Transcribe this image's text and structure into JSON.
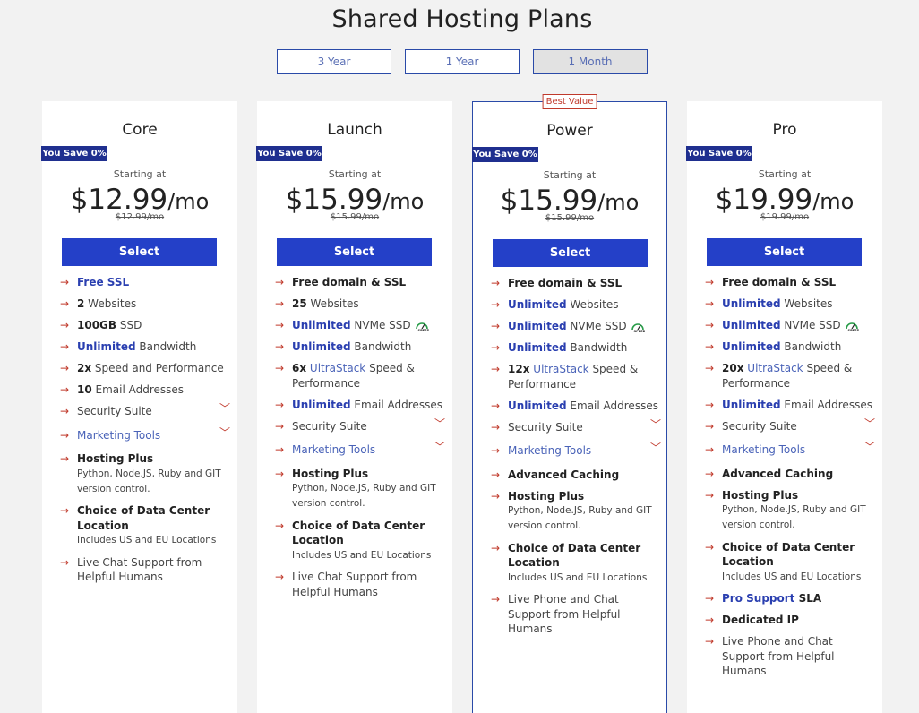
{
  "page": {
    "title": "Shared Hosting Plans"
  },
  "terms": [
    {
      "label": "3 Year",
      "active": false
    },
    {
      "label": "1 Year",
      "active": false
    },
    {
      "label": "1 Month",
      "active": true
    }
  ],
  "plans": [
    {
      "name": "Core",
      "badge": "",
      "save": "You Save 0%",
      "starting": "Starting at",
      "price": "$12.99",
      "per": "/mo",
      "old_price": "$12.99/mo",
      "button": "Select",
      "features": [
        [
          {
            "t": "Free SSL",
            "s": "blue"
          }
        ],
        [
          {
            "t": "2",
            "s": "b"
          },
          {
            "t": " Websites",
            "s": ""
          }
        ],
        [
          {
            "t": "100GB",
            "s": "b"
          },
          {
            "t": " SSD",
            "s": ""
          }
        ],
        [
          {
            "t": "Unlimited",
            "s": "blue"
          },
          {
            "t": " Bandwidth",
            "s": ""
          }
        ],
        [
          {
            "t": "2x",
            "s": "b"
          },
          {
            "t": " Speed and Performance",
            "s": ""
          }
        ],
        [
          {
            "t": "10",
            "s": "b"
          },
          {
            "t": " Email Addresses",
            "s": ""
          }
        ],
        [
          {
            "t": "Security Suite",
            "s": "",
            "exp": true
          }
        ],
        [
          {
            "t": "Marketing Tools",
            "s": "link",
            "exp": true
          }
        ],
        [
          {
            "t": "Hosting Plus",
            "s": "b"
          },
          {
            "t": "Python,   Node.JS,   Ruby and GIT version control.",
            "s": "sub"
          }
        ],
        [
          {
            "t": "Choice of Data Center Location",
            "s": "b"
          },
          {
            "t": "Includes US and EU Locations",
            "s": "sub"
          }
        ],
        [
          {
            "t": "Live Chat Support from Helpful Humans",
            "s": ""
          }
        ]
      ]
    },
    {
      "name": "Launch",
      "badge": "",
      "save": "You Save 0%",
      "starting": "Starting at",
      "price": "$15.99",
      "per": "/mo",
      "old_price": "$15.99/mo",
      "button": "Select",
      "features": [
        [
          {
            "t": "Free domain & SSL",
            "s": "b"
          }
        ],
        [
          {
            "t": "25",
            "s": "b"
          },
          {
            "t": " Websites",
            "s": ""
          }
        ],
        [
          {
            "t": "Unlimited",
            "s": "blue"
          },
          {
            "t": " NVMe SSD",
            "s": "",
            "speed": true
          }
        ],
        [
          {
            "t": "Unlimited",
            "s": "blue"
          },
          {
            "t": " Bandwidth",
            "s": ""
          }
        ],
        [
          {
            "t": "6x",
            "s": "b"
          },
          {
            "t": " ",
            "s": ""
          },
          {
            "t": "UltraStack",
            "s": "link"
          },
          {
            "t": " Speed & Performance",
            "s": ""
          }
        ],
        [
          {
            "t": "Unlimited",
            "s": "blue"
          },
          {
            "t": " Email Addresses",
            "s": ""
          }
        ],
        [
          {
            "t": "Security Suite",
            "s": "",
            "exp": true
          }
        ],
        [
          {
            "t": "Marketing Tools",
            "s": "link",
            "exp": true
          }
        ],
        [
          {
            "t": "Hosting Plus",
            "s": "b"
          },
          {
            "t": "Python,   Node.JS,   Ruby and GIT version control.",
            "s": "sub"
          }
        ],
        [
          {
            "t": "Choice of Data Center Location",
            "s": "b"
          },
          {
            "t": "Includes US and EU Locations",
            "s": "sub"
          }
        ],
        [
          {
            "t": "Live Chat Support from Helpful Humans",
            "s": ""
          }
        ]
      ]
    },
    {
      "name": "Power",
      "badge": "Best Value",
      "save": "You Save 0%",
      "starting": "Starting at",
      "price": "$15.99",
      "per": "/mo",
      "old_price": "$15.99/mo",
      "button": "Select",
      "features": [
        [
          {
            "t": "Free domain & SSL",
            "s": "b"
          }
        ],
        [
          {
            "t": "Unlimited",
            "s": "blue"
          },
          {
            "t": " Websites",
            "s": ""
          }
        ],
        [
          {
            "t": "Unlimited",
            "s": "blue"
          },
          {
            "t": " NVMe SSD",
            "s": "",
            "speed": true
          }
        ],
        [
          {
            "t": "Unlimited",
            "s": "blue"
          },
          {
            "t": " Bandwidth",
            "s": ""
          }
        ],
        [
          {
            "t": "12x",
            "s": "b"
          },
          {
            "t": " ",
            "s": ""
          },
          {
            "t": "UltraStack",
            "s": "link"
          },
          {
            "t": " Speed & Performance",
            "s": ""
          }
        ],
        [
          {
            "t": "Unlimited",
            "s": "blue"
          },
          {
            "t": " Email Addresses",
            "s": ""
          }
        ],
        [
          {
            "t": "Security Suite",
            "s": "",
            "exp": true
          }
        ],
        [
          {
            "t": "Marketing Tools",
            "s": "link",
            "exp": true
          }
        ],
        [
          {
            "t": "Advanced Caching",
            "s": "b"
          }
        ],
        [
          {
            "t": "Hosting Plus",
            "s": "b"
          },
          {
            "t": "Python,   Node.JS,   Ruby and GIT version control.",
            "s": "sub"
          }
        ],
        [
          {
            "t": "Choice of Data Center Location",
            "s": "b"
          },
          {
            "t": "Includes US and EU Locations",
            "s": "sub"
          }
        ],
        [
          {
            "t": "Live Phone and Chat Support from Helpful Humans",
            "s": ""
          }
        ]
      ]
    },
    {
      "name": "Pro",
      "badge": "",
      "save": "You Save 0%",
      "starting": "Starting at",
      "price": "$19.99",
      "per": "/mo",
      "old_price": "$19.99/mo",
      "button": "Select",
      "features": [
        [
          {
            "t": "Free domain & SSL",
            "s": "b"
          }
        ],
        [
          {
            "t": "Unlimited",
            "s": "blue"
          },
          {
            "t": " Websites",
            "s": ""
          }
        ],
        [
          {
            "t": "Unlimited",
            "s": "blue"
          },
          {
            "t": " NVMe SSD",
            "s": "",
            "speed": true
          }
        ],
        [
          {
            "t": "Unlimited",
            "s": "blue"
          },
          {
            "t": " Bandwidth",
            "s": ""
          }
        ],
        [
          {
            "t": "20x",
            "s": "b"
          },
          {
            "t": " ",
            "s": ""
          },
          {
            "t": "UltraStack",
            "s": "link"
          },
          {
            "t": " Speed & Performance",
            "s": ""
          }
        ],
        [
          {
            "t": "Unlimited",
            "s": "blue"
          },
          {
            "t": " Email Addresses",
            "s": ""
          }
        ],
        [
          {
            "t": "Security Suite",
            "s": "",
            "exp": true
          }
        ],
        [
          {
            "t": "Marketing Tools",
            "s": "link",
            "exp": true
          }
        ],
        [
          {
            "t": "Advanced Caching",
            "s": "b"
          }
        ],
        [
          {
            "t": "Hosting Plus",
            "s": "b"
          },
          {
            "t": "Python,   Node.JS,   Ruby and GIT version control.",
            "s": "sub"
          }
        ],
        [
          {
            "t": "Choice of Data Center Location",
            "s": "b"
          },
          {
            "t": "Includes US and EU Locations",
            "s": "sub"
          }
        ],
        [
          {
            "t": "Pro Support",
            "s": "blue"
          },
          {
            "t": " SLA",
            "s": "b"
          }
        ],
        [
          {
            "t": "Dedicated IP",
            "s": "b"
          }
        ],
        [
          {
            "t": "Live Phone and Chat Support from Helpful Humans",
            "s": ""
          }
        ]
      ]
    }
  ],
  "icons": {
    "arrow": "arrow-right-icon",
    "chevron": "chevron-down-icon",
    "speed": "speed-icon"
  },
  "colors": {
    "accent": "#2440c8",
    "save_tag": "#1f2f8f",
    "arrow": "#c0392b",
    "background": "#f2f2f2"
  }
}
